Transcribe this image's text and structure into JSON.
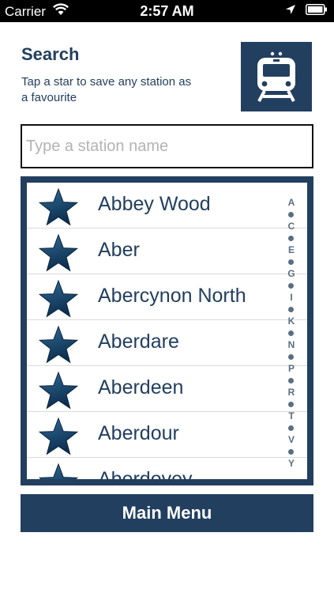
{
  "status_bar": {
    "carrier": "Carrier",
    "time": "2:57 AM",
    "wifi_icon": "wifi-icon",
    "location_icon": "location-arrow-icon",
    "battery_icon": "battery-icon"
  },
  "header": {
    "title": "Search",
    "subtitle": "Tap a star to save any station as a favourite",
    "train_icon": "train-icon"
  },
  "search": {
    "placeholder": "Type a station name",
    "value": ""
  },
  "stations": [
    {
      "name": "Abbey Wood",
      "icon": "star-icon"
    },
    {
      "name": "Aber",
      "icon": "star-icon"
    },
    {
      "name": "Abercynon North",
      "icon": "star-icon"
    },
    {
      "name": "Aberdare",
      "icon": "star-icon"
    },
    {
      "name": "Aberdeen",
      "icon": "star-icon"
    },
    {
      "name": "Aberdour",
      "icon": "star-icon"
    },
    {
      "name": "Aberdovey",
      "icon": "star-icon"
    }
  ],
  "index_letters": [
    "A",
    "C",
    "E",
    "G",
    "I",
    "K",
    "N",
    "P",
    "R",
    "T",
    "V",
    "Y"
  ],
  "main_menu_label": "Main Menu",
  "colors": {
    "brand": "#223f5f",
    "star_dark": "#0d2f4f",
    "star_light": "#2f6a94"
  }
}
